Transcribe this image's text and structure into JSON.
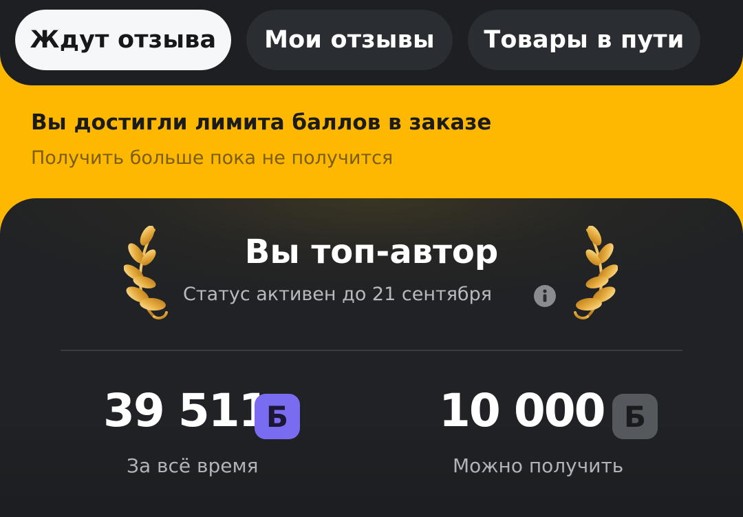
{
  "tabs": [
    {
      "label": "Ждут отзыва",
      "active": true
    },
    {
      "label": "Мои отзывы",
      "active": false
    },
    {
      "label": "Товары в пути",
      "active": false
    }
  ],
  "notice": {
    "title": "Вы достигли лимита баллов в заказе",
    "subtitle": "Получить больше пока не получится"
  },
  "author_card": {
    "title": "Вы топ-автор",
    "status": "Статус активен до 21 сентября",
    "info_icon": "info-icon",
    "laurel_icon": "laurel-icon",
    "stats": [
      {
        "value": "39 511",
        "badge": "Б",
        "label": "За всё время",
        "badge_color": "#7a6cf0"
      },
      {
        "value": "10 000",
        "badge": "Б",
        "label": "Можно получить",
        "badge_color": "#55585c"
      }
    ]
  },
  "colors": {
    "background": "#ffb800",
    "panel": "#1d1f22",
    "tab_active": "#f6f7f9",
    "tab_inactive": "#2a2d31",
    "accent_points": "#7a6cf0",
    "gold": "#e3b045"
  }
}
